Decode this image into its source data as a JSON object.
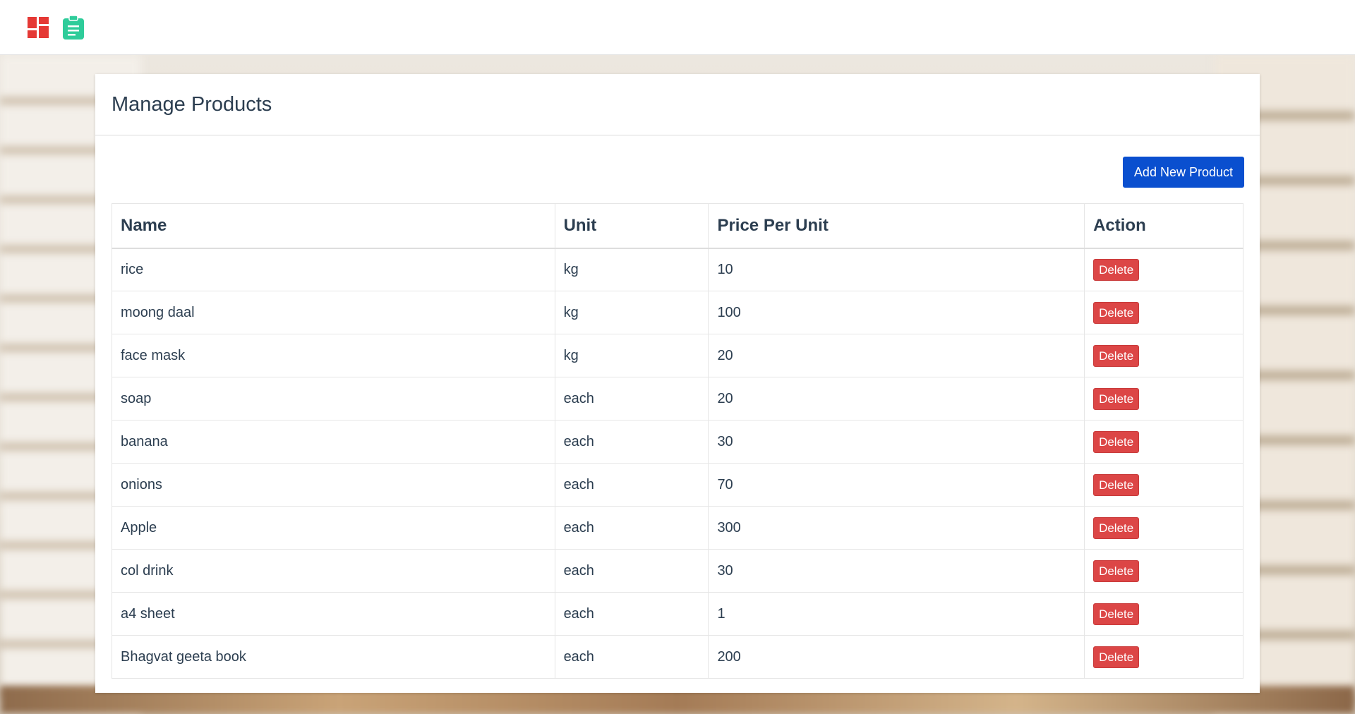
{
  "navbar": {
    "icons": [
      {
        "name": "dashboard-icon",
        "color": "#e53935"
      },
      {
        "name": "clipboard-icon",
        "color": "#2ecc9a"
      }
    ]
  },
  "page": {
    "title": "Manage Products",
    "add_button_label": "Add New Product"
  },
  "table": {
    "headers": [
      "Name",
      "Unit",
      "Price Per Unit",
      "Action"
    ],
    "rows": [
      {
        "name": "rice",
        "unit": "kg",
        "price": "10",
        "action": "Delete"
      },
      {
        "name": "moong daal",
        "unit": "kg",
        "price": "100",
        "action": "Delete"
      },
      {
        "name": "face mask",
        "unit": "kg",
        "price": "20",
        "action": "Delete"
      },
      {
        "name": "soap",
        "unit": "each",
        "price": "20",
        "action": "Delete"
      },
      {
        "name": "banana",
        "unit": "each",
        "price": "30",
        "action": "Delete"
      },
      {
        "name": "onions",
        "unit": "each",
        "price": "70",
        "action": "Delete"
      },
      {
        "name": "Apple",
        "unit": "each",
        "price": "300",
        "action": "Delete"
      },
      {
        "name": "col drink",
        "unit": "each",
        "price": "30",
        "action": "Delete"
      },
      {
        "name": "a4 sheet",
        "unit": "each",
        "price": "1",
        "action": "Delete"
      },
      {
        "name": "Bhagvat geeta book",
        "unit": "each",
        "price": "200",
        "action": "Delete"
      }
    ]
  },
  "colors": {
    "primary_button": "#0a4fcf",
    "danger_button": "#dc4646",
    "text": "#2c3e50"
  }
}
